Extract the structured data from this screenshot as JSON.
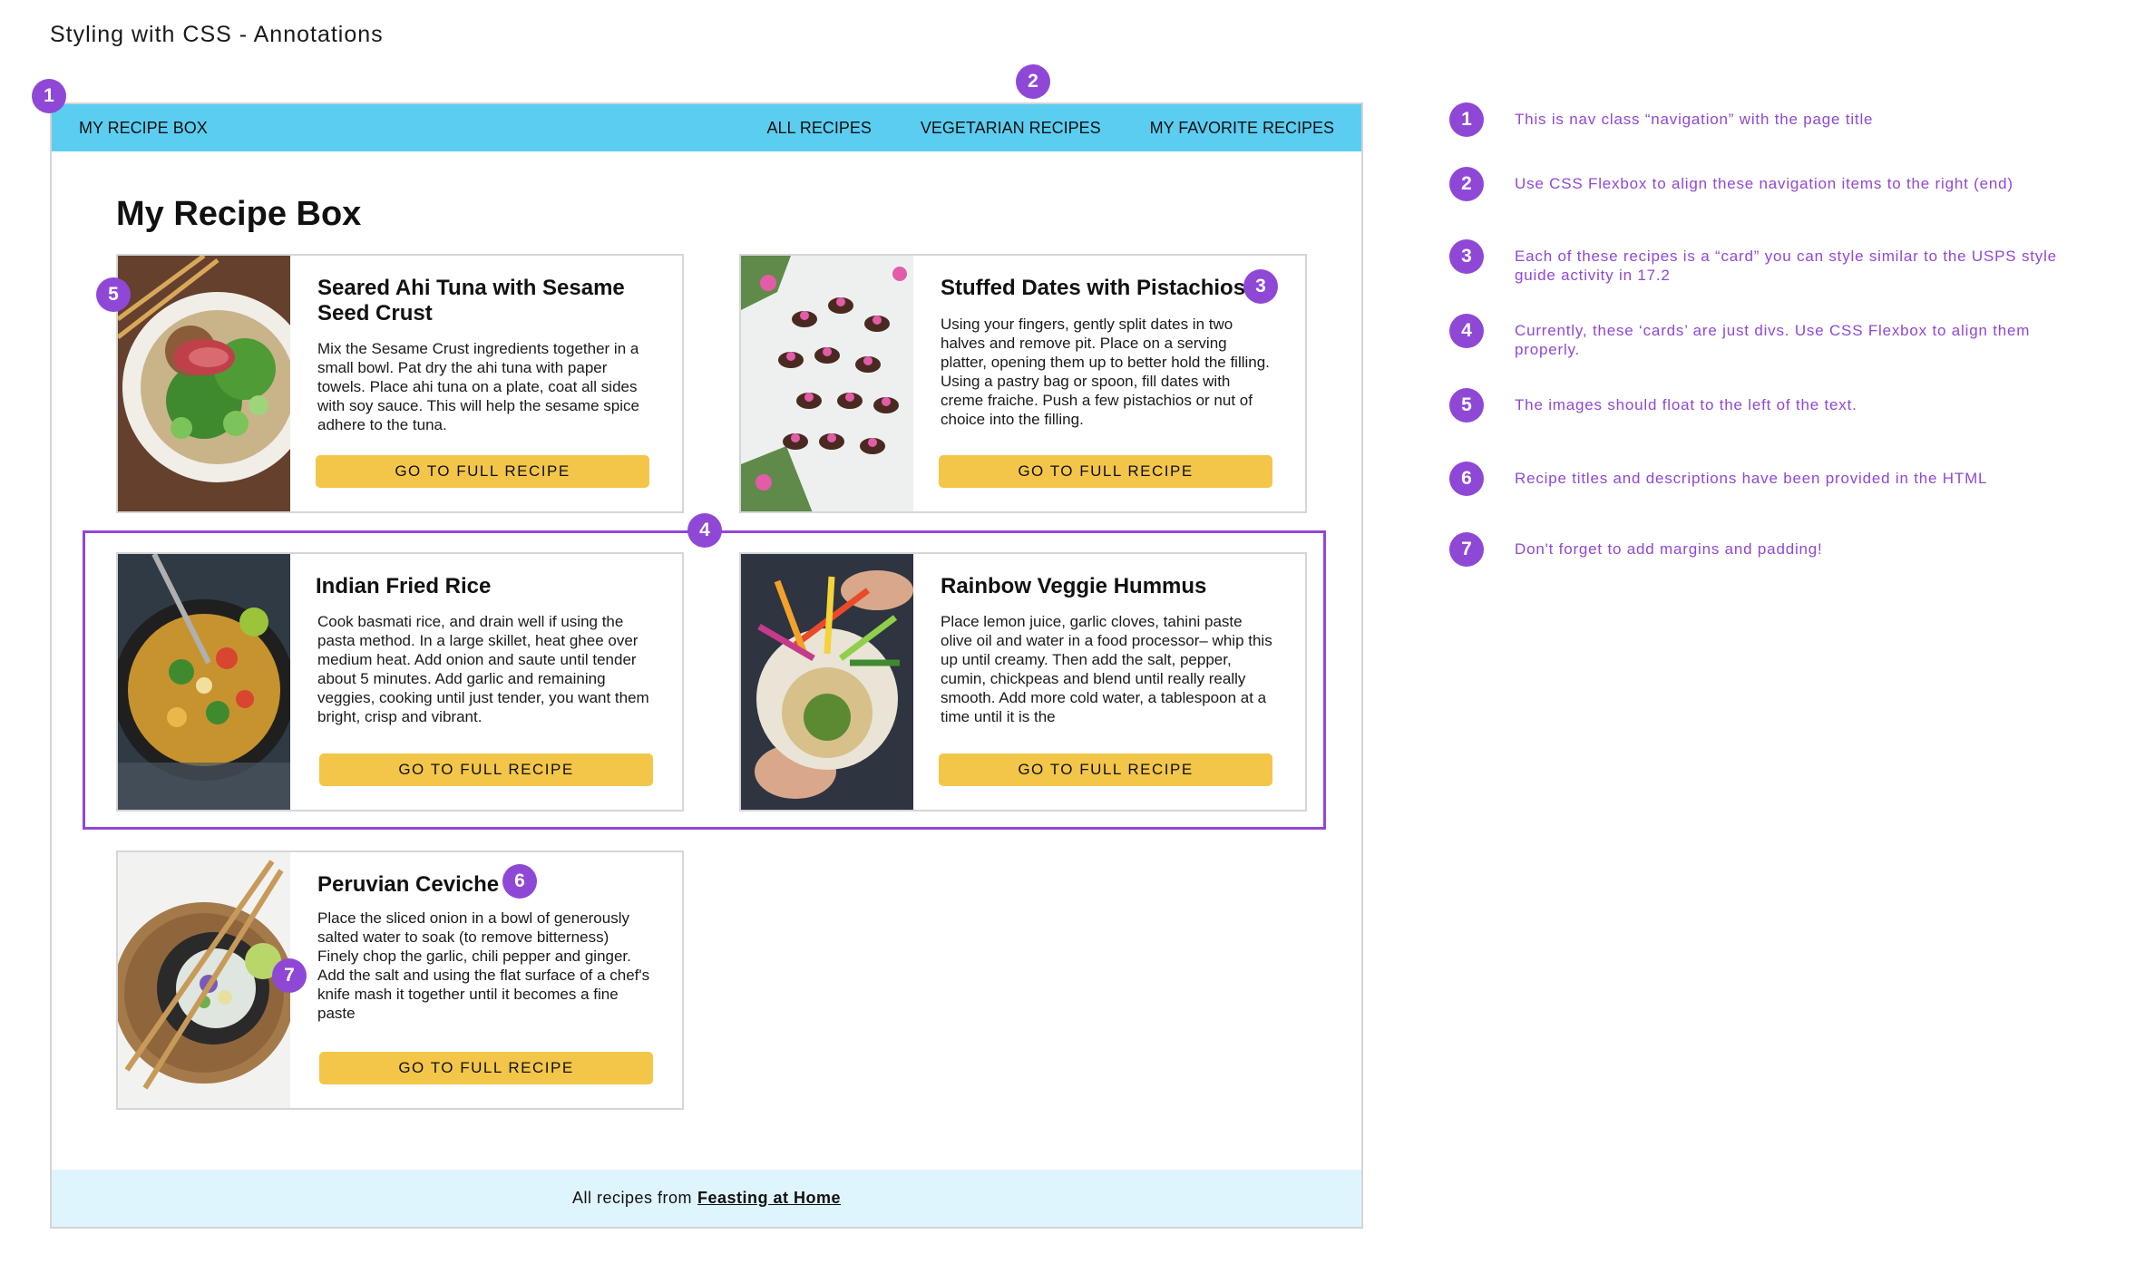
{
  "page_title": "Styling with CSS - Annotations",
  "nav": {
    "title": "MY RECIPE BOX",
    "links": [
      "ALL RECIPES",
      "VEGETARIAN RECIPES",
      "MY FAVORITE RECIPES"
    ]
  },
  "main_title": "My Recipe Box",
  "cards": [
    {
      "title": "Seared Ahi Tuna with Sesame Seed Crust",
      "description": "Mix the Sesame Crust ingredients together in a small bowl. Pat dry the ahi tuna with paper towels. Place ahi tuna on a plate, coat all sides with soy sauce. This will help the sesame spice adhere to the tuna.",
      "button": "GO TO FULL RECIPE"
    },
    {
      "title": "Stuffed Dates with Pistachios",
      "description": "Using your fingers, gently split dates in two halves and remove pit. Place on a serving platter, opening them up to better hold the filling. Using a pastry bag or spoon, fill dates with creme fraiche. Push a few pistachios or nut of choice into the filling.",
      "button": "GO TO FULL RECIPE"
    },
    {
      "title": "Indian Fried Rice",
      "description": "Cook basmati rice, and drain well if using the pasta method. In a large skillet, heat ghee over medium heat. Add onion and saute until tender about 5 minutes. Add garlic and remaining veggies, cooking until just tender, you want them bright, crisp and vibrant.",
      "button": "GO TO FULL RECIPE"
    },
    {
      "title": "Rainbow Veggie Hummus",
      "description": "Place lemon juice, garlic cloves, tahini paste olive oil and water in a food processor– whip this up until creamy. Then add the salt, pepper, cumin, chickpeas and blend until really really smooth. Add more cold water, a tablespoon at a time until it is the",
      "button": "GO TO FULL RECIPE"
    },
    {
      "title": "Peruvian Ceviche",
      "description": "Place the sliced onion in a bowl of generously salted water to soak (to remove bitterness) Finely chop the garlic, chili pepper and ginger. Add the salt and using the flat surface of a chef's knife mash it together until it becomes a fine paste",
      "button": "GO TO FULL RECIPE"
    }
  ],
  "footer": {
    "text": "All recipes from",
    "link": "Feasting at Home"
  },
  "badges": [
    "1",
    "2",
    "3",
    "4",
    "5",
    "6",
    "7"
  ],
  "notes": [
    {
      "num": "1",
      "text": "This is nav class “navigation” with the page title"
    },
    {
      "num": "2",
      "text": "Use CSS Flexbox to align these navigation items to the right (end)"
    },
    {
      "num": "3",
      "text": "Each of these recipes is a “card” you can style similar to the USPS style guide activity in 17.2"
    },
    {
      "num": "4",
      "text": "Currently, these ‘cards’ are just divs. Use CSS Flexbox to align them properly."
    },
    {
      "num": "5",
      "text": "The images should float to the left of the text."
    },
    {
      "num": "6",
      "text": "Recipe titles and descriptions have been provided in the HTML"
    },
    {
      "num": "7",
      "text": "Don't forget to add margins and padding!"
    }
  ],
  "colors": {
    "nav_bg": "#5bcdf1",
    "accent_purple": "#8f48d6",
    "button_yellow": "#f3c649",
    "footer_bg": "#dff5fd"
  }
}
